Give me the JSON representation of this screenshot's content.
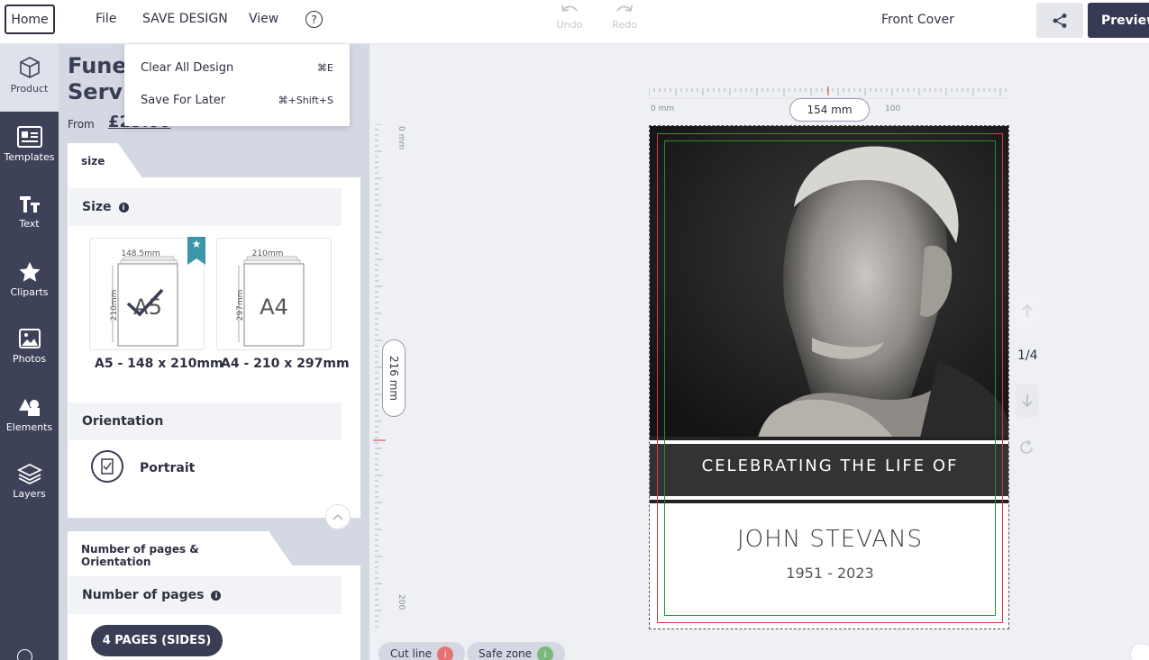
{
  "topbar": {
    "home_label": "Home",
    "menu": [
      "File",
      "SAVE DESIGN",
      "View"
    ],
    "help_label": "?",
    "undo_label": "Undo",
    "redo_label": "Redo",
    "current_page": "Front Cover",
    "preview_label": "Preview"
  },
  "dropdown": {
    "items": [
      {
        "label": "Clear All Design",
        "shortcut": "⌘E"
      },
      {
        "label": "Save For Later",
        "shortcut": "⌘+Shift+S"
      }
    ]
  },
  "sidebar": {
    "items": [
      {
        "label": "Product",
        "icon": "box-icon"
      },
      {
        "label": "Templates",
        "icon": "templates-icon"
      },
      {
        "label": "Text",
        "icon": "text-icon"
      },
      {
        "label": "Cliparts",
        "icon": "star-icon"
      },
      {
        "label": "Photos",
        "icon": "photo-icon"
      },
      {
        "label": "Elements",
        "icon": "shapes-icon"
      },
      {
        "label": "Layers",
        "icon": "layers-icon"
      }
    ]
  },
  "panel": {
    "product_title": "Funeral\nService",
    "from_label": "From",
    "price": "£25.00",
    "size_tab": "size",
    "size_heading": "Size",
    "sizes": [
      {
        "name": "A5",
        "width_label": "148.5mm",
        "height_label": "210mm",
        "caption": "A5 - 148 x 210mm",
        "selected": true
      },
      {
        "name": "A4",
        "width_label": "210mm",
        "height_label": "297mm",
        "caption": "A4 - 210 x 297mm",
        "selected": false
      }
    ],
    "orientation_heading": "Orientation",
    "orientation_value": "Portrait",
    "pages_tab": "Number of pages & Orientation",
    "pages_heading": "Number of pages",
    "pages_value": "4 PAGES (SIDES)"
  },
  "canvas": {
    "width_label": "154 mm",
    "height_label": "216 mm",
    "ruler_top_zero": "0 mm",
    "ruler_top_100": "100",
    "ruler_left_zero": "0 mm",
    "ruler_left_200": "200",
    "banner_text": "CELEBRATING THE LIFE OF",
    "name": "JOHN STEVANS",
    "years": "1951 - 2023",
    "page_count": "1/4",
    "legend": [
      {
        "label": "Cut line",
        "color": "#e57373"
      },
      {
        "label": "Safe zone",
        "color": "#7cb87c"
      }
    ]
  },
  "colors": {
    "sidebar": "#3e4259",
    "panel": "#d4d8e3",
    "accent": "#363a52",
    "bookmark": "#3b97a8"
  }
}
